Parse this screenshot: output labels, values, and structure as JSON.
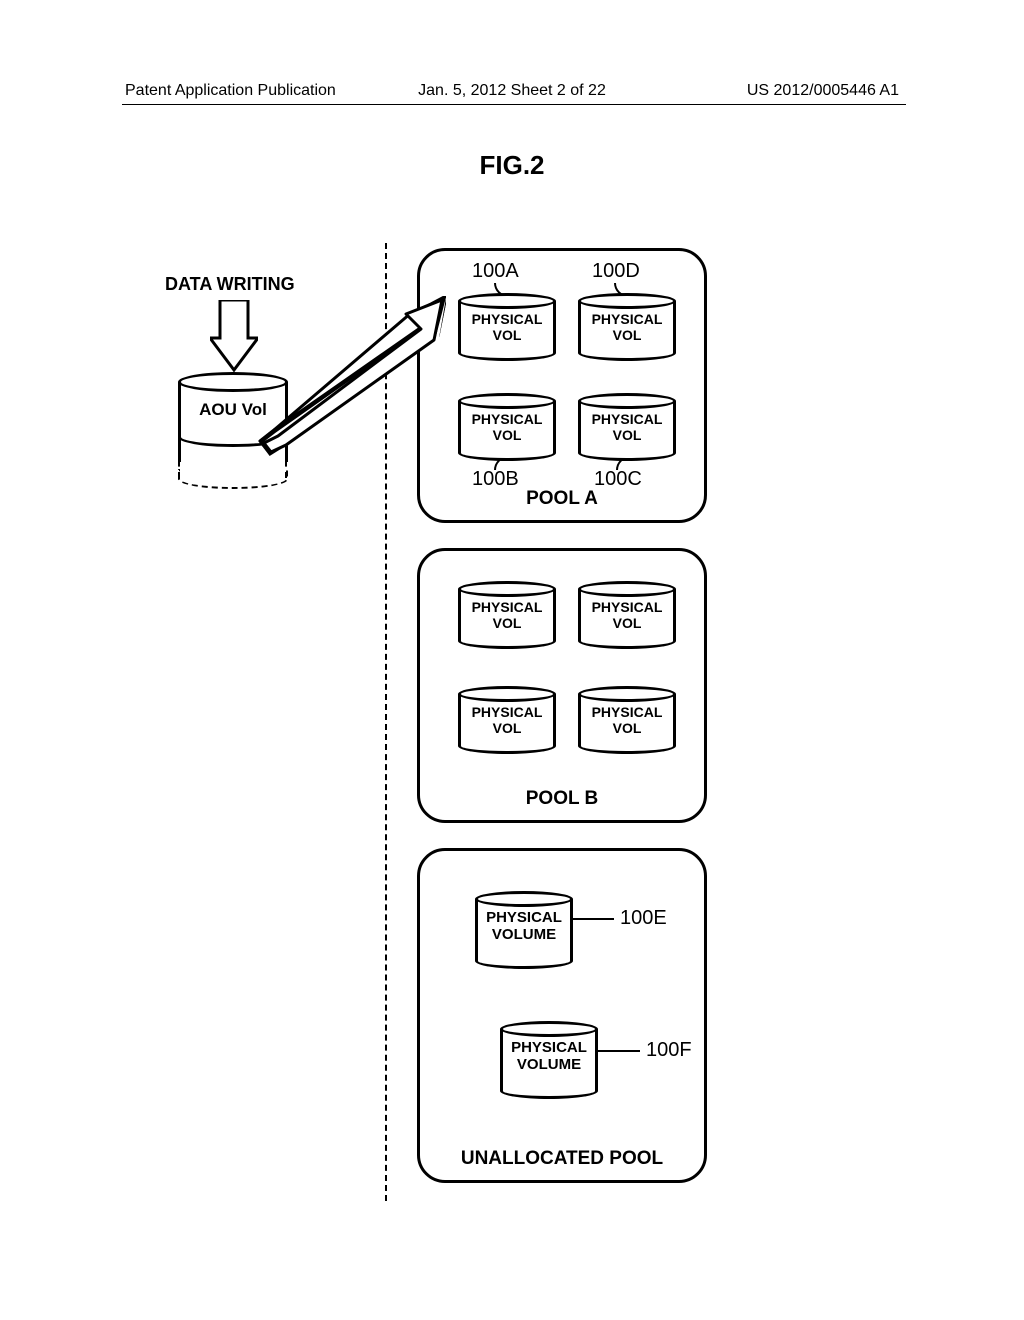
{
  "header": {
    "left": "Patent Application Publication",
    "center": "Jan. 5, 2012  Sheet 2 of 22",
    "right": "US 2012/0005446 A1"
  },
  "figure_title": "FIG.2",
  "data_writing_label": "DATA WRITING",
  "aou_vol_label": "AOU Vol",
  "pools": {
    "a": {
      "label": "POOL A",
      "vols": [
        {
          "label_line1": "PHYSICAL",
          "label_line2": "VOL",
          "callout": "100A"
        },
        {
          "label_line1": "PHYSICAL",
          "label_line2": "VOL",
          "callout": "100D"
        },
        {
          "label_line1": "PHYSICAL",
          "label_line2": "VOL",
          "callout": "100B"
        },
        {
          "label_line1": "PHYSICAL",
          "label_line2": "VOL",
          "callout": "100C"
        }
      ]
    },
    "b": {
      "label": "POOL B",
      "vols": [
        {
          "label_line1": "PHYSICAL",
          "label_line2": "VOL"
        },
        {
          "label_line1": "PHYSICAL",
          "label_line2": "VOL"
        },
        {
          "label_line1": "PHYSICAL",
          "label_line2": "VOL"
        },
        {
          "label_line1": "PHYSICAL",
          "label_line2": "VOL"
        }
      ]
    },
    "unalloc": {
      "label": "UNALLOCATED POOL",
      "vols": [
        {
          "label_line1": "PHYSICAL",
          "label_line2": "VOLUME",
          "callout": "100E"
        },
        {
          "label_line1": "PHYSICAL",
          "label_line2": "VOLUME",
          "callout": "100F"
        }
      ]
    }
  }
}
